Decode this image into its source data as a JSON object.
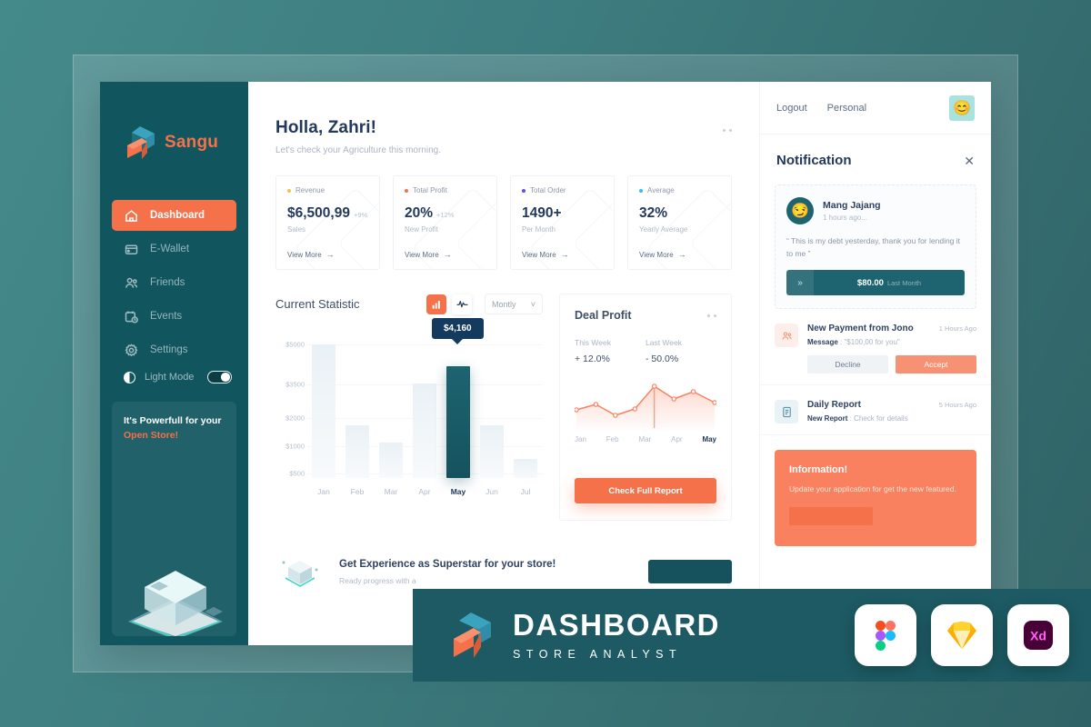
{
  "brand": {
    "name": "Sangu"
  },
  "sidebar": {
    "items": [
      {
        "label": "Dashboard",
        "icon": "home-icon",
        "active": true
      },
      {
        "label": "E-Wallet",
        "icon": "wallet-icon",
        "active": false
      },
      {
        "label": "Friends",
        "icon": "people-icon",
        "active": false
      },
      {
        "label": "Events",
        "icon": "calendar-clock-icon",
        "active": false
      },
      {
        "label": "Settings",
        "icon": "gear-icon",
        "active": false
      }
    ],
    "light_mode": {
      "label": "Light Mode",
      "enabled": true
    },
    "promo": {
      "line1": "It's Powerfull for your",
      "line2": "Open Store!"
    }
  },
  "header": {
    "greeting": "Holla, Zahri!",
    "subtitle": "Let's check your Agriculture this morning."
  },
  "stats": [
    {
      "label": "Revenue",
      "dot": "#f2c14e",
      "value": "$6,500,99",
      "delta": "+9%",
      "caption": "Sales",
      "more": "View More"
    },
    {
      "label": "Total Profit",
      "dot": "#f4714a",
      "value": "20%",
      "delta": "+12%",
      "caption": "New Profit",
      "more": "View More"
    },
    {
      "label": "Total Order",
      "dot": "#5b4df0",
      "value": "1490+",
      "delta": "",
      "caption": "Per Month",
      "more": "View More"
    },
    {
      "label": "Average",
      "dot": "#38bdf0",
      "value": "32%",
      "delta": "",
      "caption": "Yearly Average",
      "more": "View More"
    }
  ],
  "statistic": {
    "title": "Current Statistic",
    "range_selected": "Montly",
    "tooltip": "$4,160"
  },
  "chart_data": {
    "type": "bar",
    "title": "Current Statistic",
    "xlabel": "",
    "ylabel": "",
    "categories": [
      "Jan",
      "Feb",
      "Mar",
      "Apr",
      "May",
      "Jun",
      "Jul"
    ],
    "values": [
      5000,
      2000,
      1350,
      3550,
      4160,
      2000,
      700
    ],
    "highlight_index": 4,
    "highlight_label": "$4,160",
    "ytick_labels": [
      "$5000",
      "$3500",
      "$2000",
      "$1000",
      "$500"
    ],
    "ytick_values": [
      5000,
      3500,
      2000,
      1000,
      500
    ],
    "ylim": [
      0,
      5400
    ],
    "grid": true,
    "legend": "none"
  },
  "deal": {
    "title": "Deal Profit",
    "this_week_label": "This Week",
    "this_week_value": "+ 12.0%",
    "last_week_label": "Last Week",
    "last_week_value": "- 50.0%",
    "months": [
      "Jan",
      "Feb",
      "Mar",
      "Apr",
      "May"
    ],
    "selected_month": "May",
    "cta": "Check Full Report",
    "sparkline": [
      36,
      44,
      26,
      34,
      82,
      60,
      70,
      52
    ]
  },
  "experience": {
    "title": "Get Experience as Superstar for your store!",
    "subtitle": "Ready progress with a"
  },
  "right": {
    "logout": "Logout",
    "personal": "Personal",
    "avatar_emoji": "😊",
    "notification_title": "Notification",
    "close": "✕",
    "featured": {
      "avatar_emoji": "😏",
      "name": "Mang Jajang",
      "time": "1 hours ago...",
      "message": "“ This is my debt yesterday, thank you for lending it to me ”",
      "amount": "$80.00",
      "amount_sub": "Last Month",
      "chevron": "»"
    },
    "items": [
      {
        "icon": "people-icon",
        "title": "New Payment from Jono",
        "time": "1 Hours Ago",
        "sub_bold": "Message",
        "sub_rest": " : \"$100,00 for you\"",
        "decline": "Decline",
        "accept": "Accept"
      },
      {
        "icon": "document-icon",
        "title": "Daily Report",
        "time": "5 Hours Ago",
        "sub_bold": "New Report",
        "sub_rest": " : Check for details",
        "decline": "",
        "accept": ""
      }
    ],
    "info": {
      "title": "Information!",
      "text": "Update your application for get the new featured."
    }
  },
  "banner": {
    "title": "DASHBOARD",
    "subtitle": "STORE ANALYST",
    "icons": [
      "figma-icon",
      "sketch-icon",
      "adobe-xd-icon"
    ],
    "xd_label": "Xd"
  }
}
